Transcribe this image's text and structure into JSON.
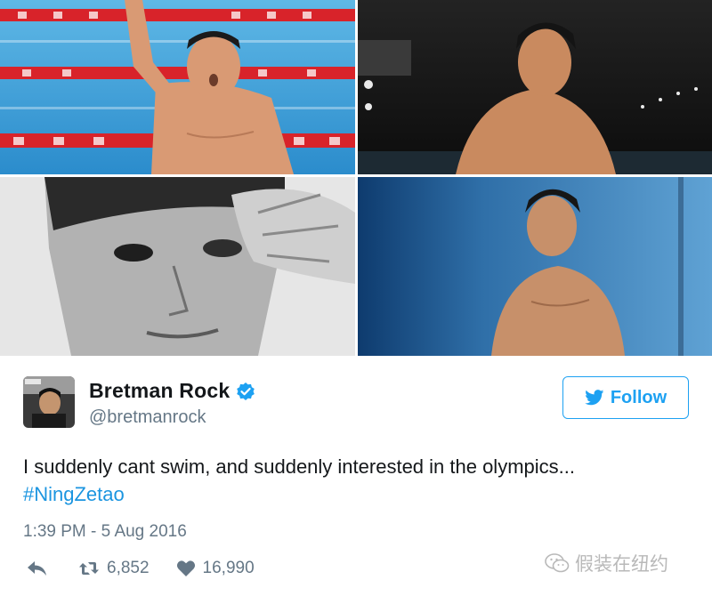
{
  "photos": [
    {
      "name": "swimmer-pool-celebration-photo"
    },
    {
      "name": "swimmer-poolside-portrait-photo"
    },
    {
      "name": "swimmer-bw-closeup-photo"
    },
    {
      "name": "swimmer-diving-block-photo"
    }
  ],
  "tweet": {
    "display_name": "Bretman Rock",
    "handle": "@bretmanrock",
    "verified_icon": "verified-badge-icon",
    "follow_label": "Follow",
    "text": "I suddenly cant swim, and suddenly interested in the olympics...",
    "hashtag": "#NingZetao",
    "timestamp": "1:39 PM - 5 Aug 2016",
    "retweets": "6,852",
    "likes": "16,990"
  },
  "watermark": {
    "text": "假装在纽约",
    "icon": "wechat-icon"
  },
  "colors": {
    "twitter_blue": "#1da1f2",
    "link_blue": "#1b95e0",
    "text_dark": "#14171a",
    "text_grey": "#657786"
  }
}
